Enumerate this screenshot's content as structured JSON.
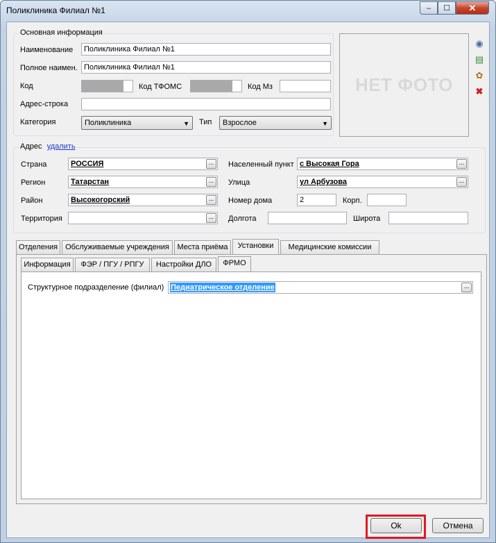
{
  "window": {
    "title": "Поликлиника Филиал №1",
    "controls": {
      "minimize": "–",
      "maximize": "☐",
      "close": "✕"
    }
  },
  "main_info": {
    "legend": "Основная информация",
    "name_label": "Наименование",
    "name_value": "Поликлиника Филиал №1",
    "fullname_label": "Полное наимен.",
    "fullname_value": "Поликлиника Филиал №1",
    "code_label": "Код",
    "code_value": "",
    "tfoms_label": "Код ТФОМС",
    "tfoms_value": "",
    "mz_label": "Код Мз",
    "mz_value": "",
    "address_line_label": "Адрес-строка",
    "address_line_value": "",
    "category_label": "Категория",
    "category_value": "Поликлиника",
    "type_label": "Тип",
    "type_value": "Взрослое",
    "photo_placeholder": "НЕТ ФОТО"
  },
  "address": {
    "legend": "Адрес",
    "delete_link": "удалить",
    "country_label": "Страна",
    "country_value": "РОССИЯ",
    "region_label": "Регион",
    "region_value": "Татарстан",
    "district_label": "Район",
    "district_value": "Высокогорский",
    "territory_label": "Территория",
    "territory_value": "",
    "locality_label": "Населенный пункт",
    "locality_value": "с Высокая Гора",
    "street_label": "Улица",
    "street_value": "ул Арбузова",
    "house_label": "Номер дома",
    "house_value": "2",
    "building_label": "Корп.",
    "building_value": "",
    "longitude_label": "Долгота",
    "longitude_value": "",
    "latitude_label": "Широта",
    "latitude_value": ""
  },
  "tabs": [
    {
      "label": "Отделения"
    },
    {
      "label": "Обслуживаемые учреждения"
    },
    {
      "label": "Места приёма"
    },
    {
      "label": "Установки"
    },
    {
      "label": "Медицинские комиссии"
    }
  ],
  "subtabs": [
    {
      "label": "Информация"
    },
    {
      "label": "ФЭР / ПГУ / РПГУ"
    },
    {
      "label": "Настройки ДЛО"
    },
    {
      "label": "ФРМО"
    }
  ],
  "frmo": {
    "subdivision_label": "Структурное подразделение (филиал)",
    "subdivision_value": "Педиатрическое отделение"
  },
  "buttons": {
    "ok": "Ok",
    "cancel": "Отмена"
  },
  "ellipsis": "..."
}
